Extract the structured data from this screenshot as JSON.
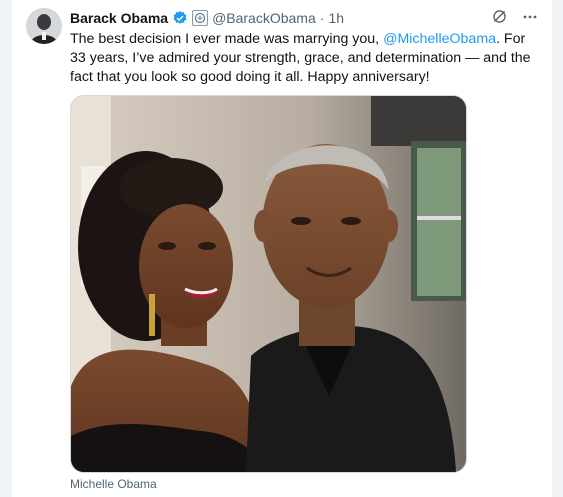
{
  "tweet": {
    "author_name": "Barack Obama",
    "handle": "@BarackObama",
    "separator": "·",
    "time": "1h",
    "text_part1": "The best decision I ever made was marrying you, ",
    "mention": "@MichelleObama",
    "text_part2": ". For 33 years, I’ve admired your strength, grace, and determination — and the fact that you look so good doing it all. Happy anniversary!",
    "media_caption": "Michelle Obama"
  },
  "colors": {
    "accent": "#1d9bf0",
    "text": "#0f1419",
    "muted": "#536471"
  },
  "icons": [
    "verified-badge-icon",
    "government-label-icon",
    "grok-icon",
    "more-icon"
  ]
}
